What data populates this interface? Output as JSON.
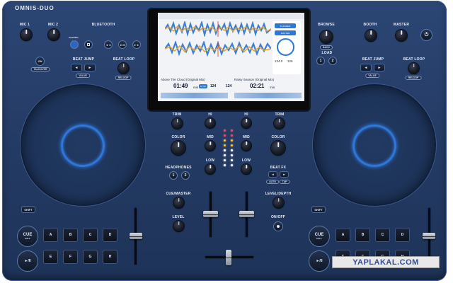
{
  "brand": "OMNIS-DUO",
  "left_deck": {
    "mic1": "MIC 1",
    "mic2": "MIC 2",
    "bluetooth": "BLUETOOTH",
    "pairing": "PAIRING",
    "talkover": "TALKOVER",
    "beat_jump": "BEAT JUMP",
    "value": "VALUE",
    "beat_loop": "BEAT LOOP",
    "reloop": "RELOOP",
    "shift": "SHIFT",
    "cue": "CUE",
    "cue_sub": "CALL",
    "play": "►/II",
    "pads": [
      "A",
      "B",
      "C",
      "D",
      "E",
      "F",
      "G",
      "H"
    ]
  },
  "right_deck": {
    "browse": "BROWSE",
    "back": "BACK",
    "booth": "BOOTH",
    "master": "MASTER",
    "load": "LOAD",
    "load_1": "1",
    "load_2": "2",
    "beat_jump": "BEAT JUMP",
    "value": "VALUE",
    "beat_loop": "BEAT LOOP",
    "reloop": "RELOOP",
    "shift": "SHIFT",
    "cue": "CUE",
    "cue_sub": "CALL",
    "play": "►/II",
    "pads": [
      "A",
      "B",
      "C",
      "D",
      "E",
      "F",
      "G",
      "H"
    ]
  },
  "mixer": {
    "trim": "TRIM",
    "hi": "HI",
    "mid": "MID",
    "low": "LOW",
    "color": "COLOR",
    "headphones": "HEADPHONES",
    "hp_1": "1",
    "hp_2": "2",
    "cue_master": "CUE/MASTER",
    "level": "LEVEL",
    "beat_fx": "BEAT FX",
    "fx_1": "◄",
    "fx_2": "►",
    "auto": "AUTO",
    "tap": "TAP",
    "level_depth": "LEVEL/DEPTH",
    "on_off": "ON/OFF"
  },
  "screen": {
    "deck1": {
      "track": "Above The Cloud (Original Mix)",
      "time": "01:49",
      "time_unit": "min",
      "bpm": "124",
      "sync": "SYNC"
    },
    "deck2": {
      "track": "Rainy Season (Original Mix)",
      "time": "02:21",
      "time_unit": "min",
      "bpm": "124"
    },
    "side_buttons": [
      "PLANNED",
      "MASTER"
    ],
    "side_values": [
      "124.0",
      "126"
    ]
  },
  "watermark": "YAPLAKAL.COM",
  "colors": {
    "body": "#233a63",
    "jog_ring": "#2f76d6",
    "waveform_blue": "#3d7fd6",
    "waveform_orange": "#e9a52a"
  }
}
